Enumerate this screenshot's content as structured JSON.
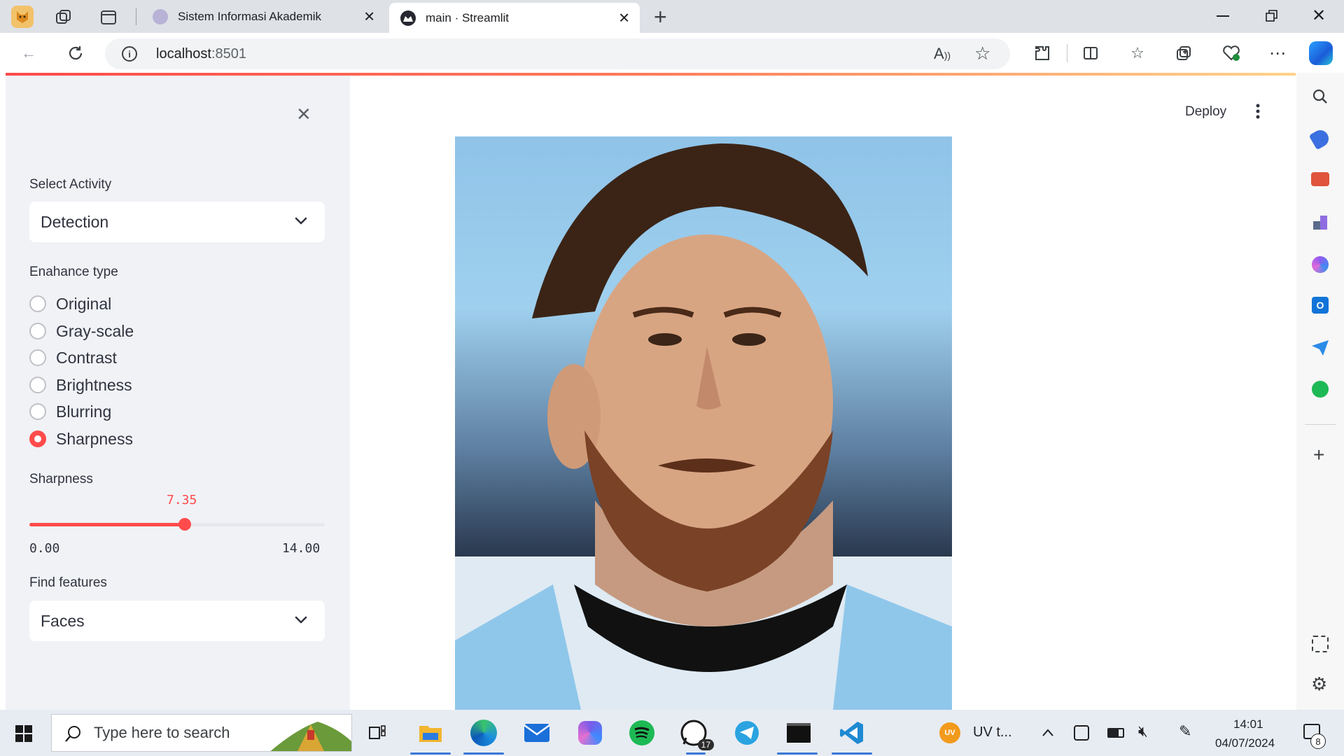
{
  "browser": {
    "tabs": [
      {
        "title": "Sistem Informasi Akademik",
        "active": false
      },
      {
        "title": "main · Streamlit",
        "active": true
      }
    ],
    "url_host": "localhost",
    "url_port": ":8501"
  },
  "app": {
    "deploy_label": "Deploy",
    "sidebar": {
      "activity_label": "Select Activity",
      "activity_value": "Detection",
      "enhance_label": "Enahance type",
      "enhance_options": [
        "Original",
        "Gray-scale",
        "Contrast",
        "Brightness",
        "Blurring",
        "Sharpness"
      ],
      "enhance_selected": "Sharpness",
      "sharpness_label": "Sharpness",
      "sharpness_value": "7.35",
      "sharpness_min": "0.00",
      "sharpness_max": "14.00",
      "sharpness_fraction": 0.525,
      "features_label": "Find features",
      "features_value": "Faces"
    },
    "main_image": "portrait-photo"
  },
  "taskbar": {
    "search_placeholder": "Type here to search",
    "whatsapp_badge": "17",
    "tray_app_label": "UV t...",
    "tray_app_initials": "UV",
    "time": "14:01",
    "date": "04/07/2024",
    "notification_count": "8"
  },
  "colors": {
    "accent": "#ff4b4b",
    "sidebar_bg": "#f0f2f6",
    "text": "#31333f"
  }
}
